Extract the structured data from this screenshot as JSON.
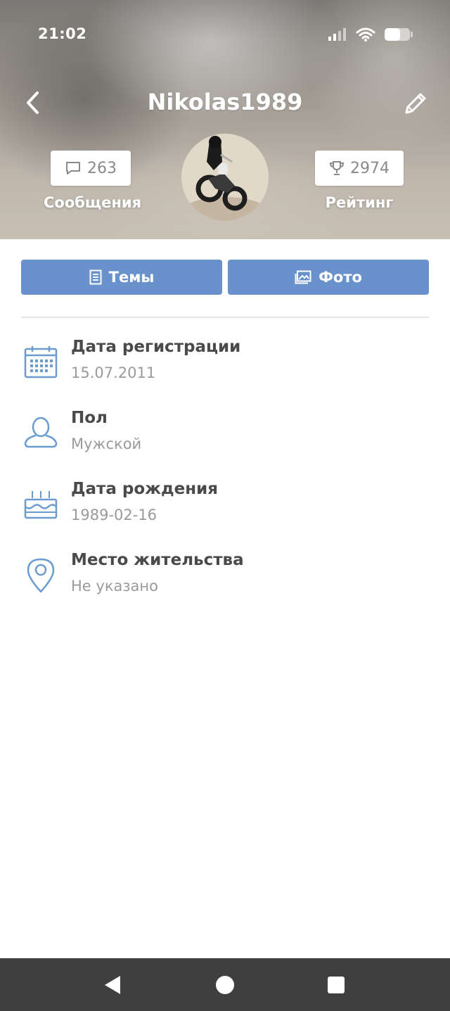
{
  "status_bar": {
    "time": "21:02"
  },
  "header": {
    "title": "Nikolas1989",
    "messages": {
      "count": "263",
      "label": "Сообщения"
    },
    "rating": {
      "count": "2974",
      "label": "Рейтинг"
    }
  },
  "tabs": [
    {
      "label": "Темы",
      "icon": "document-icon"
    },
    {
      "label": "Фото",
      "icon": "photo-icon"
    }
  ],
  "info": [
    {
      "title": "Дата регистрации",
      "value": "15.07.2011",
      "icon": "calendar-icon"
    },
    {
      "title": "Пол",
      "value": "Мужской",
      "icon": "user-icon"
    },
    {
      "title": "Дата рождения",
      "value": "1989-02-16",
      "icon": "birthday-cake-icon"
    },
    {
      "title": "Место жительства",
      "value": "Не указано",
      "icon": "location-pin-icon"
    }
  ],
  "colors": {
    "accent": "#6991cb",
    "icon_blue": "#6a9bd1",
    "nav_bar": "#3f3f3f",
    "title_text": "#4a4a4a",
    "value_text": "#9a9a9a"
  }
}
